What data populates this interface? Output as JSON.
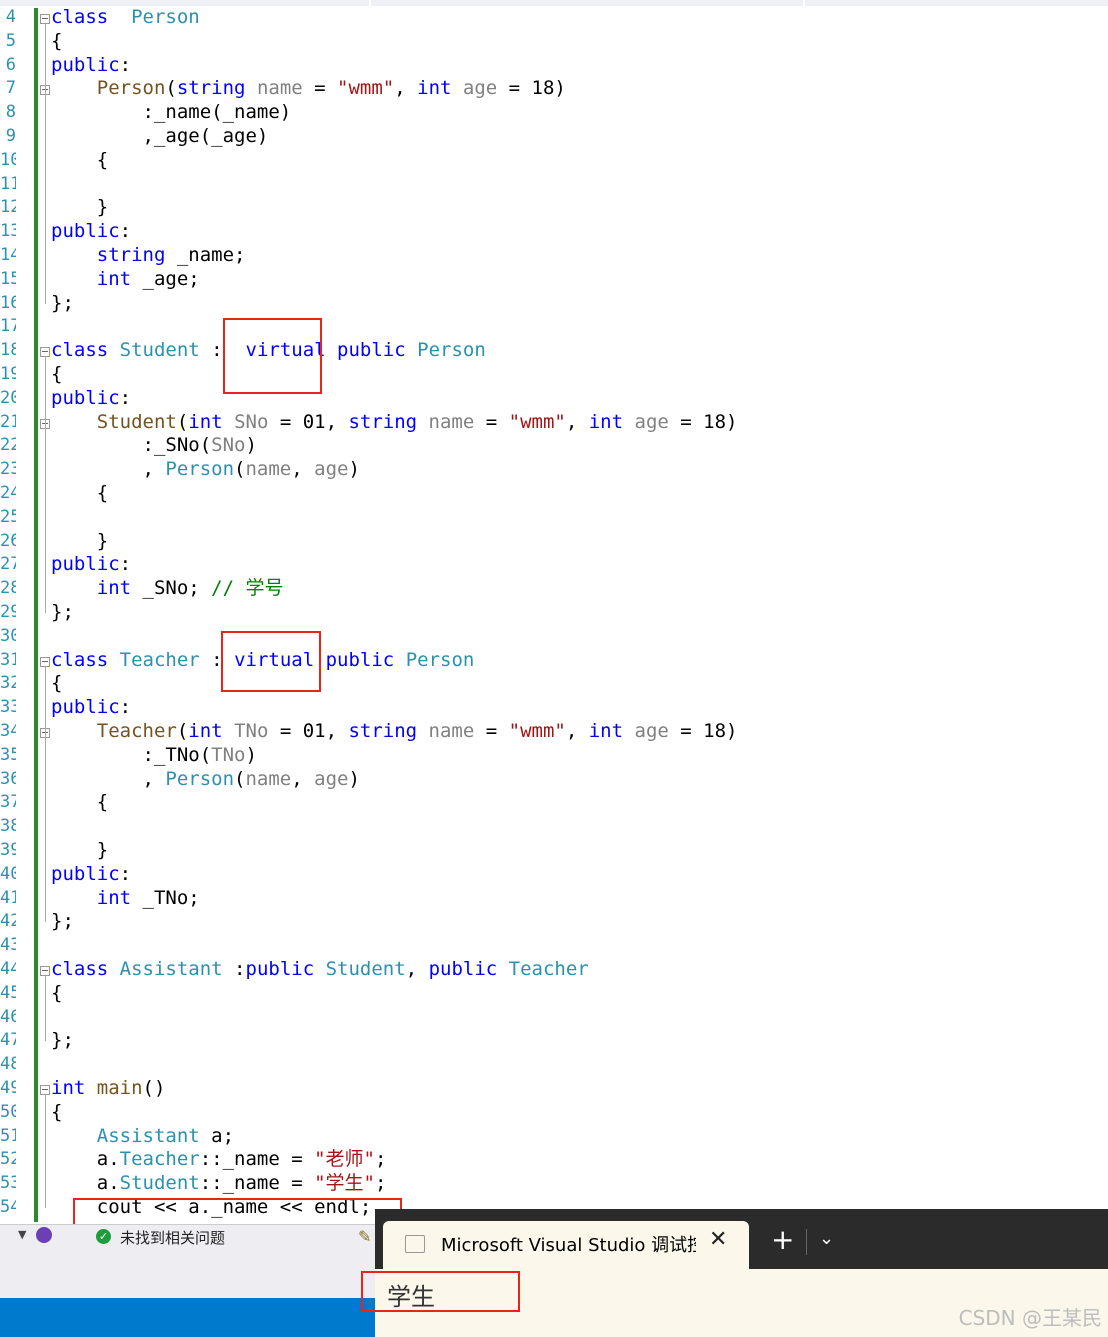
{
  "editor": {
    "line_numbers": [
      "4",
      "5",
      "6",
      "7",
      "8",
      "9",
      "10",
      "11",
      "12",
      "13",
      "14",
      "15",
      "16",
      "17",
      "18",
      "19",
      "20",
      "21",
      "22",
      "23",
      "24",
      "25",
      "26",
      "27",
      "28",
      "29",
      "30",
      "31",
      "32",
      "33",
      "34",
      "35",
      "36",
      "37",
      "38",
      "39",
      "40",
      "41",
      "42",
      "43",
      "44",
      "45",
      "46",
      "47",
      "48",
      "49",
      "50",
      "51",
      "52",
      "53",
      "54"
    ],
    "lines": [
      [
        [
          "kw",
          "class"
        ],
        [
          "",
          "  "
        ],
        [
          "ty",
          "Person"
        ]
      ],
      [
        [
          "",
          "{"
        ]
      ],
      [
        [
          "kw",
          "public"
        ],
        [
          "",
          ":"
        ]
      ],
      [
        [
          "",
          "    "
        ],
        [
          "fn",
          "Person"
        ],
        [
          "",
          "("
        ],
        [
          "kw",
          "string"
        ],
        [
          "",
          ""
        ],
        [
          "pr",
          " name"
        ],
        [
          "",
          " = "
        ],
        [
          "st",
          "\"wmm\""
        ],
        [
          "",
          ", "
        ],
        [
          "kw",
          "int"
        ],
        [
          "pr",
          " age"
        ],
        [
          "",
          " = 18)"
        ]
      ],
      [
        [
          "",
          "        :_name(_name)"
        ]
      ],
      [
        [
          "",
          "        ,_age(_age)"
        ]
      ],
      [
        [
          "",
          "    {"
        ]
      ],
      [
        [
          "",
          ""
        ]
      ],
      [
        [
          "",
          "    }"
        ]
      ],
      [
        [
          "kw",
          "public"
        ],
        [
          "",
          ":"
        ]
      ],
      [
        [
          "",
          "    "
        ],
        [
          "kw",
          "string"
        ],
        [
          "",
          " _name;"
        ]
      ],
      [
        [
          "",
          "    "
        ],
        [
          "kw",
          "int"
        ],
        [
          "",
          " _age;"
        ]
      ],
      [
        [
          "",
          "};"
        ]
      ],
      [
        [
          "",
          ""
        ]
      ],
      [
        [
          "kw",
          "class"
        ],
        [
          "",
          " "
        ],
        [
          "ty",
          "Student"
        ],
        [
          "",
          " :  "
        ],
        [
          "kw",
          "virtual"
        ],
        [
          "",
          " "
        ],
        [
          "kw",
          "public"
        ],
        [
          "",
          " "
        ],
        [
          "ty",
          "Person"
        ]
      ],
      [
        [
          "",
          "{"
        ]
      ],
      [
        [
          "kw",
          "public"
        ],
        [
          "",
          ":"
        ]
      ],
      [
        [
          "",
          "    "
        ],
        [
          "fn",
          "Student"
        ],
        [
          "",
          "("
        ],
        [
          "kw",
          "int"
        ],
        [
          "pr",
          " SNo"
        ],
        [
          "",
          " = 01, "
        ],
        [
          "kw",
          "string"
        ],
        [
          "pr",
          " name"
        ],
        [
          "",
          " = "
        ],
        [
          "st",
          "\"wmm\""
        ],
        [
          "",
          ", "
        ],
        [
          "kw",
          "int"
        ],
        [
          "pr",
          " age"
        ],
        [
          "",
          " = 18)"
        ]
      ],
      [
        [
          "",
          "        :_SNo("
        ],
        [
          "pr",
          "SNo"
        ],
        [
          "",
          ")"
        ]
      ],
      [
        [
          "",
          "        , "
        ],
        [
          "ty",
          "Person"
        ],
        [
          "",
          "("
        ],
        [
          "pr",
          "name"
        ],
        [
          "",
          ", "
        ],
        [
          "pr",
          "age"
        ],
        [
          "",
          ")"
        ]
      ],
      [
        [
          "",
          "    {"
        ]
      ],
      [
        [
          "",
          ""
        ]
      ],
      [
        [
          "",
          "    }"
        ]
      ],
      [
        [
          "kw",
          "public"
        ],
        [
          "",
          ":"
        ]
      ],
      [
        [
          "",
          "    "
        ],
        [
          "kw",
          "int"
        ],
        [
          "",
          " _SNo; "
        ],
        [
          "cm",
          "// 学号"
        ]
      ],
      [
        [
          "",
          "};"
        ]
      ],
      [
        [
          "",
          ""
        ]
      ],
      [
        [
          "kw",
          "class"
        ],
        [
          "",
          " "
        ],
        [
          "ty",
          "Teacher"
        ],
        [
          "",
          " : "
        ],
        [
          "kw",
          "virtual"
        ],
        [
          "",
          " "
        ],
        [
          "kw",
          "public"
        ],
        [
          "",
          " "
        ],
        [
          "ty",
          "Person"
        ]
      ],
      [
        [
          "",
          "{"
        ]
      ],
      [
        [
          "kw",
          "public"
        ],
        [
          "",
          ":"
        ]
      ],
      [
        [
          "",
          "    "
        ],
        [
          "fn",
          "Teacher"
        ],
        [
          "",
          "("
        ],
        [
          "kw",
          "int"
        ],
        [
          "pr",
          " TNo"
        ],
        [
          "",
          " = 01, "
        ],
        [
          "kw",
          "string"
        ],
        [
          "pr",
          " name"
        ],
        [
          "",
          " = "
        ],
        [
          "st",
          "\"wmm\""
        ],
        [
          "",
          ", "
        ],
        [
          "kw",
          "int"
        ],
        [
          "pr",
          " age"
        ],
        [
          "",
          " = 18)"
        ]
      ],
      [
        [
          "",
          "        :_TNo("
        ],
        [
          "pr",
          "TNo"
        ],
        [
          "",
          ")"
        ]
      ],
      [
        [
          "",
          "        , "
        ],
        [
          "ty",
          "Person"
        ],
        [
          "",
          "("
        ],
        [
          "pr",
          "name"
        ],
        [
          "",
          ", "
        ],
        [
          "pr",
          "age"
        ],
        [
          "",
          ")"
        ]
      ],
      [
        [
          "",
          "    {"
        ]
      ],
      [
        [
          "",
          ""
        ]
      ],
      [
        [
          "",
          "    }"
        ]
      ],
      [
        [
          "kw",
          "public"
        ],
        [
          "",
          ":"
        ]
      ],
      [
        [
          "",
          "    "
        ],
        [
          "kw",
          "int"
        ],
        [
          "",
          " _TNo;"
        ]
      ],
      [
        [
          "",
          "};"
        ]
      ],
      [
        [
          "",
          ""
        ]
      ],
      [
        [
          "kw",
          "class"
        ],
        [
          "",
          " "
        ],
        [
          "ty",
          "Assistant"
        ],
        [
          "",
          " :"
        ],
        [
          "kw",
          "public"
        ],
        [
          "",
          " "
        ],
        [
          "ty",
          "Student"
        ],
        [
          "",
          ", "
        ],
        [
          "kw",
          "public"
        ],
        [
          "",
          " "
        ],
        [
          "ty",
          "Teacher"
        ]
      ],
      [
        [
          "",
          "{"
        ]
      ],
      [
        [
          "",
          ""
        ]
      ],
      [
        [
          "",
          "};"
        ]
      ],
      [
        [
          "",
          ""
        ]
      ],
      [
        [
          "kw",
          "int"
        ],
        [
          "",
          " "
        ],
        [
          "fn",
          "main"
        ],
        [
          "",
          "()"
        ]
      ],
      [
        [
          "",
          "{"
        ]
      ],
      [
        [
          "",
          "    "
        ],
        [
          "ty",
          "Assistant"
        ],
        [
          "",
          " a;"
        ]
      ],
      [
        [
          "",
          "    a."
        ],
        [
          "ty",
          "Teacher"
        ],
        [
          "",
          "::_name = "
        ],
        [
          "st",
          "\"老师\""
        ],
        [
          "",
          ";"
        ]
      ],
      [
        [
          "",
          "    a."
        ],
        [
          "ty",
          "Student"
        ],
        [
          "",
          "::_name = "
        ],
        [
          "st",
          "\"学生\""
        ],
        [
          "",
          ";"
        ]
      ],
      [
        [
          "",
          "    cout << a._name << endl;"
        ]
      ]
    ]
  },
  "status": {
    "issues_text": "未找到相关问题"
  },
  "console": {
    "tab_title": "Microsoft Visual Studio 调试控制台",
    "close_glyph": "✕",
    "new_tab_glyph": "+",
    "dropdown_glyph": "⌄",
    "output": "学生"
  },
  "watermark": "CSDN @王某民",
  "colors": {
    "keyword": "#0000ff",
    "type": "#2b91af",
    "string": "#a31515",
    "comment": "#008000",
    "highlight_box": "#e8241b",
    "change_bar": "#2a8a2a"
  }
}
